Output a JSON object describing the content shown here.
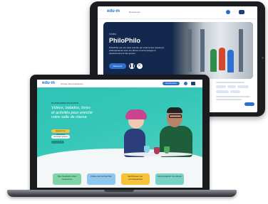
{
  "tablet": {
    "logo": "edu·m",
    "nav": "Ressources",
    "hero_tag": "Vidéo",
    "hero_title": "PhiloPhilo",
    "hero_desc": "PhiloPhilo est une série animée qui explore des questions philosophiques avec les élèves et accompagne le questionnement des jeunes.",
    "hero_button": "Découvrir"
  },
  "laptop": {
    "logo": "edu·m",
    "nav_items": [
      "Accueil",
      "Nos ressources"
    ],
    "search_label": "Rechercher",
    "hero_tag": "PLATEFORME ÉDUCATIVE",
    "hero_title": "Vidéos, balados, livres et activités pour enrichir votre salle de classe",
    "button_primary": "Explorer les ressources",
    "button_secondary": "Inscription gratuite",
    "cards": [
      {
        "label": "Des résultats et des ressources",
        "color": "#7fd3a6"
      },
      {
        "label": "Faites des recherches",
        "color": "#8fc7ee"
      },
      {
        "label": "Enrichissez vos connaissances",
        "color": "#f6c238"
      },
      {
        "label": "Accompagnez vos élèves",
        "color": "#79d2c4"
      }
    ]
  },
  "colors": {
    "accent": "#2f6fcf",
    "hero_teal": "#34c7b8",
    "tablet_hero": "#12294d",
    "device_frame": "#1a1b1e"
  }
}
